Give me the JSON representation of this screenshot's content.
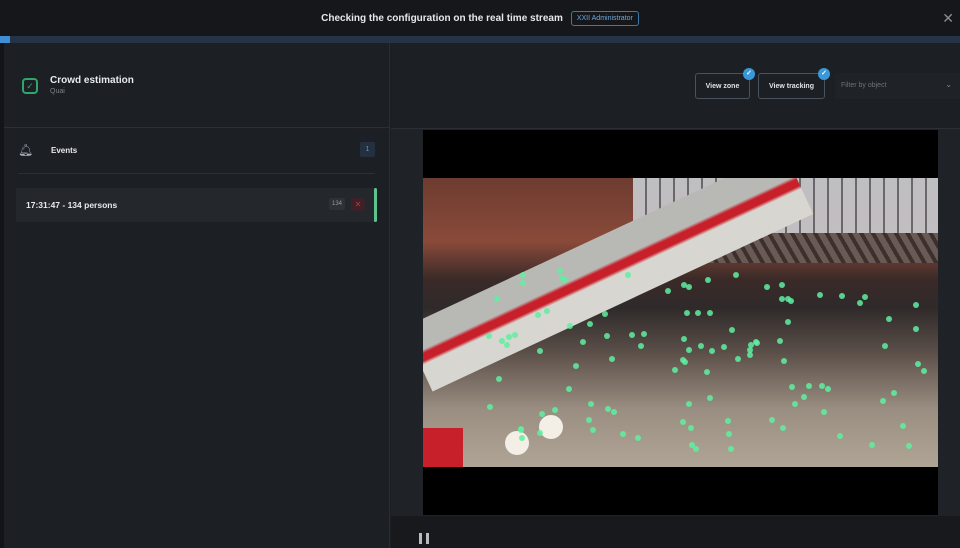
{
  "topbar": {
    "title": "Checking the configuration on the real time stream",
    "user_badge": "XXII Administrator",
    "close": "✕"
  },
  "stream_progress_percent": 1,
  "sidebar": {
    "app_name": "Crowd estimation",
    "location": "Quai",
    "events": {
      "label": "Events",
      "count": "1",
      "items": [
        {
          "text": "17:31:47  -  134 persons",
          "count": "134",
          "delete": "✕"
        }
      ]
    }
  },
  "toolbar": {
    "view_zone": "View zone",
    "view_tracking": "View tracking",
    "filter_placeholder": "Filter by object",
    "check": "✓",
    "chevron": "⌄"
  },
  "colors": {
    "accent": "#3a98d8",
    "success": "#5cc58d",
    "danger": "#cc3333"
  }
}
